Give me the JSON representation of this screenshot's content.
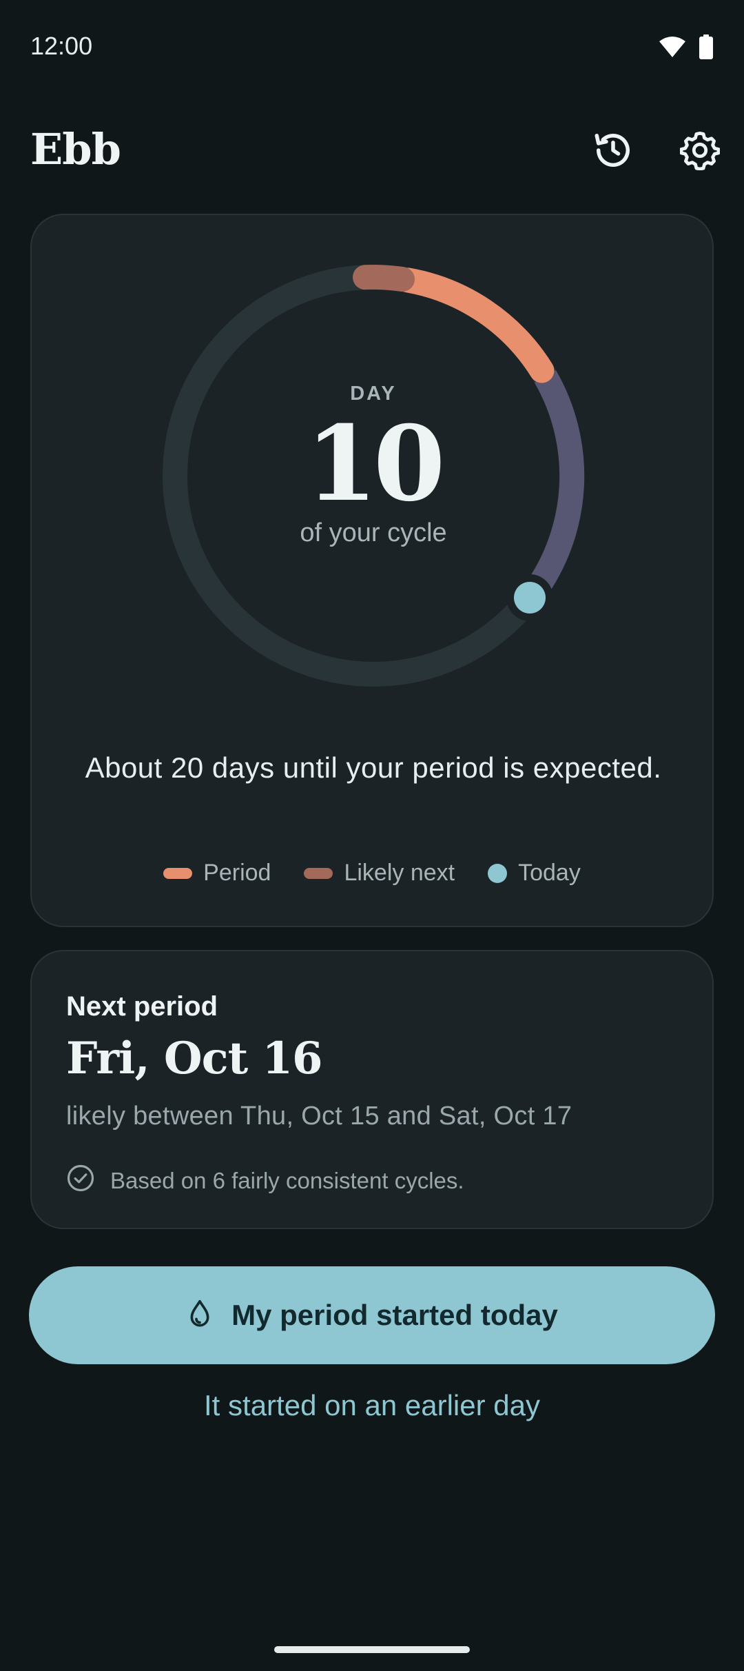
{
  "status": {
    "time": "12:00",
    "wifi_icon": "wifi-icon",
    "battery_icon": "battery-icon"
  },
  "app_bar": {
    "title": "Ebb",
    "history_icon": "history-icon",
    "settings_icon": "gear-icon"
  },
  "cycle": {
    "day_label": "DAY",
    "day_number": "10",
    "day_sub": "of your cycle",
    "countdown": "About 20 days until your period is expected.",
    "legend": {
      "period": "Period",
      "likely_next": "Likely next",
      "today": "Today"
    },
    "colors": {
      "period": "#e8906e",
      "likely_next": "#a3695a",
      "today": "#8ec6d1",
      "fertile": "#575673",
      "track": "#283438"
    }
  },
  "next_period": {
    "label": "Next period",
    "date": "Fri, Oct 16",
    "range": "likely between Thu, Oct 15 and Sat, Oct 17",
    "basis": "Based on 6 fairly consistent cycles."
  },
  "actions": {
    "primary": "My period started today",
    "primary_icon": "drop-icon",
    "secondary": "It started on an earlier day"
  }
}
